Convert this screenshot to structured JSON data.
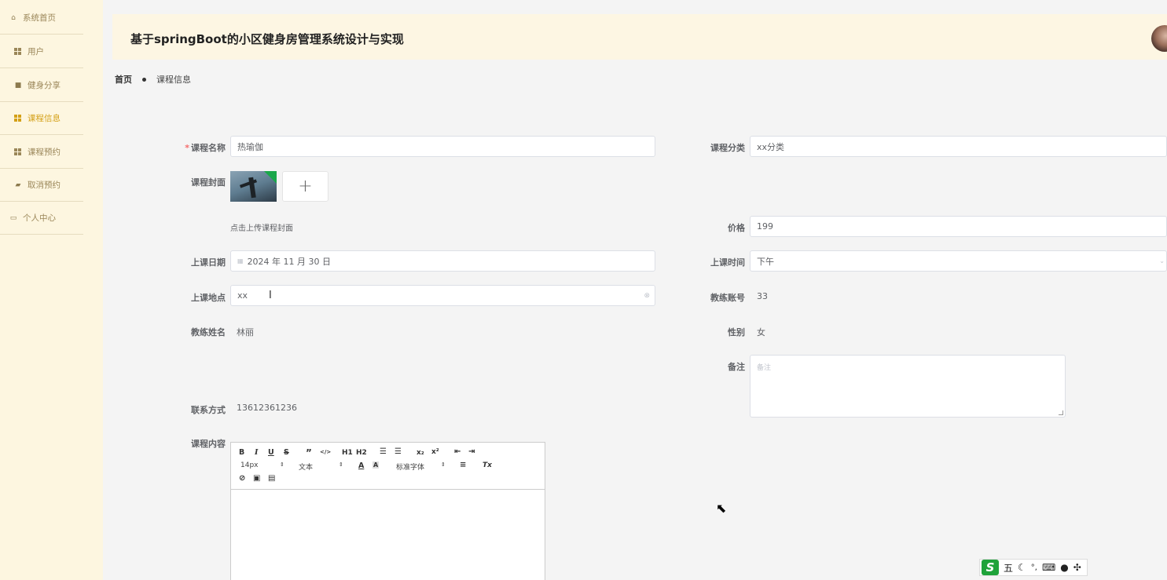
{
  "sidebar": {
    "home": "系统首页",
    "items": [
      {
        "label": "用户"
      },
      {
        "label": "健身分享"
      },
      {
        "label": "课程信息"
      },
      {
        "label": "课程预约"
      },
      {
        "label": "取消预约"
      }
    ],
    "personal": "个人中心",
    "active_color": "#d4a017"
  },
  "header": {
    "title": "基于springBoot的小区健身房管理系统设计与实现"
  },
  "breadcrumb": {
    "home": "首页",
    "current": "课程信息"
  },
  "form": {
    "course_name": {
      "label": "课程名称",
      "value": "热瑜伽",
      "required": true
    },
    "category": {
      "label": "课程分类",
      "value": "xx分类"
    },
    "cover": {
      "label": "课程封面",
      "upload_icon": "+",
      "hint": "点击上传课程封面"
    },
    "price": {
      "label": "价格",
      "value": "199"
    },
    "date": {
      "label": "上课日期",
      "value": "2024 年 11 月 30 日"
    },
    "time": {
      "label": "上课时间",
      "value": "下午"
    },
    "location": {
      "label": "上课地点",
      "value": "xx"
    },
    "coach_account": {
      "label": "教练账号",
      "value": "33"
    },
    "coach_name": {
      "label": "教练姓名",
      "value": "林丽"
    },
    "gender": {
      "label": "性别",
      "value": "女"
    },
    "remark": {
      "label": "备注",
      "placeholder": "备注"
    },
    "contact": {
      "label": "联系方式",
      "value": "13612361236"
    },
    "content": {
      "label": "课程内容"
    }
  },
  "editor": {
    "font_size": "14px",
    "block_type": "文本",
    "font_family": "标准字体",
    "buttons": [
      "B",
      "I",
      "U",
      "S",
      "”",
      "</>",
      "H1",
      "H2",
      "ol",
      "ul",
      "x₂",
      "x²",
      "outdent",
      "indent",
      "A",
      "A",
      "align",
      "Tx",
      "link",
      "image",
      "video"
    ]
  },
  "ime": {
    "logo": "S",
    "mode": "五"
  }
}
